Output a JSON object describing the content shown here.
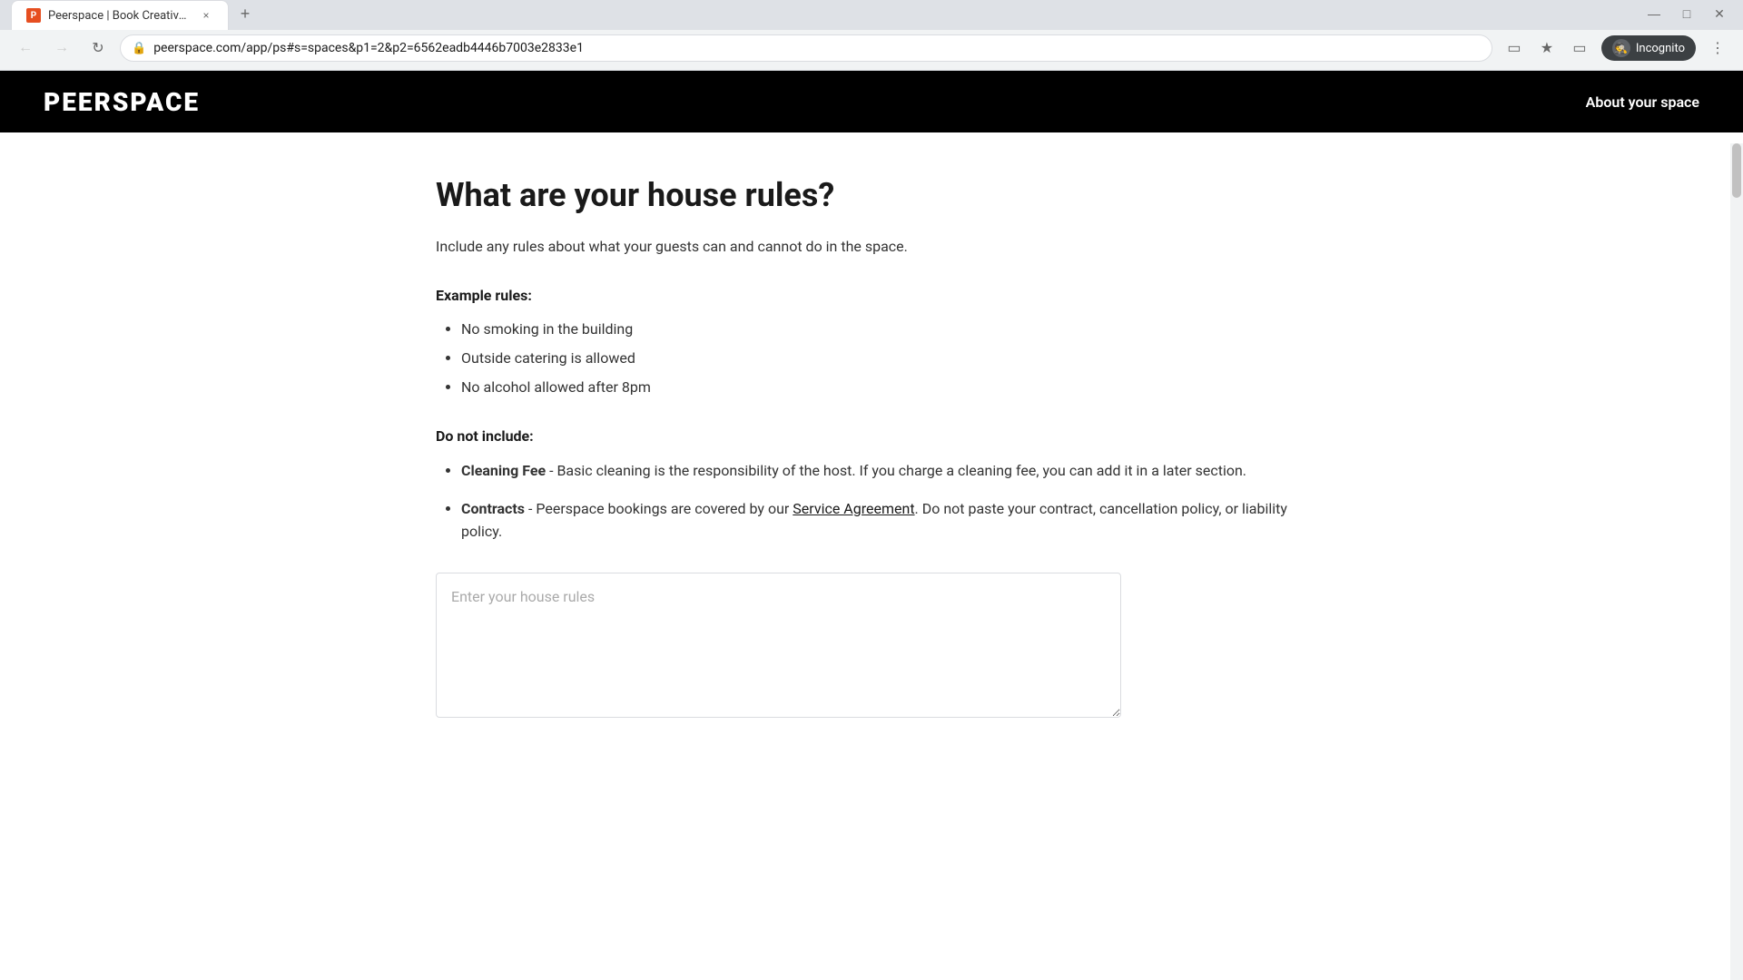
{
  "browser": {
    "tab_favicon": "P",
    "tab_title": "Peerspace | Book Creative Space",
    "tab_close": "×",
    "new_tab": "+",
    "url": "peerspace.com/app/ps#s=spaces&p1=2&p2=6562eadb4446b7003e2833e1",
    "incognito_label": "Incognito",
    "nav": {
      "back": "←",
      "forward": "→",
      "reload": "↻"
    }
  },
  "header": {
    "logo": "PEERSPACE",
    "nav_link": "About your space"
  },
  "page": {
    "title": "What are your house rules?",
    "subtitle": "Include any rules about what your guests can and cannot do in the space.",
    "example_rules_label": "Example rules:",
    "example_rules": [
      "No smoking in the building",
      "Outside catering is allowed",
      "No alcohol allowed after 8pm"
    ],
    "do_not_include_label": "Do not include:",
    "do_not_items": [
      {
        "bold": "Cleaning Fee",
        "text": " - Basic cleaning is the responsibility of the host. If you charge a cleaning fee, you can add it in a later section."
      },
      {
        "bold": "Contracts",
        "text": " - Peerspace bookings are covered by our ",
        "link": "Service Agreement",
        "text_after": ". Do not paste your contract, cancellation policy, or liability policy."
      }
    ],
    "textarea_placeholder": "Enter your house rules"
  }
}
